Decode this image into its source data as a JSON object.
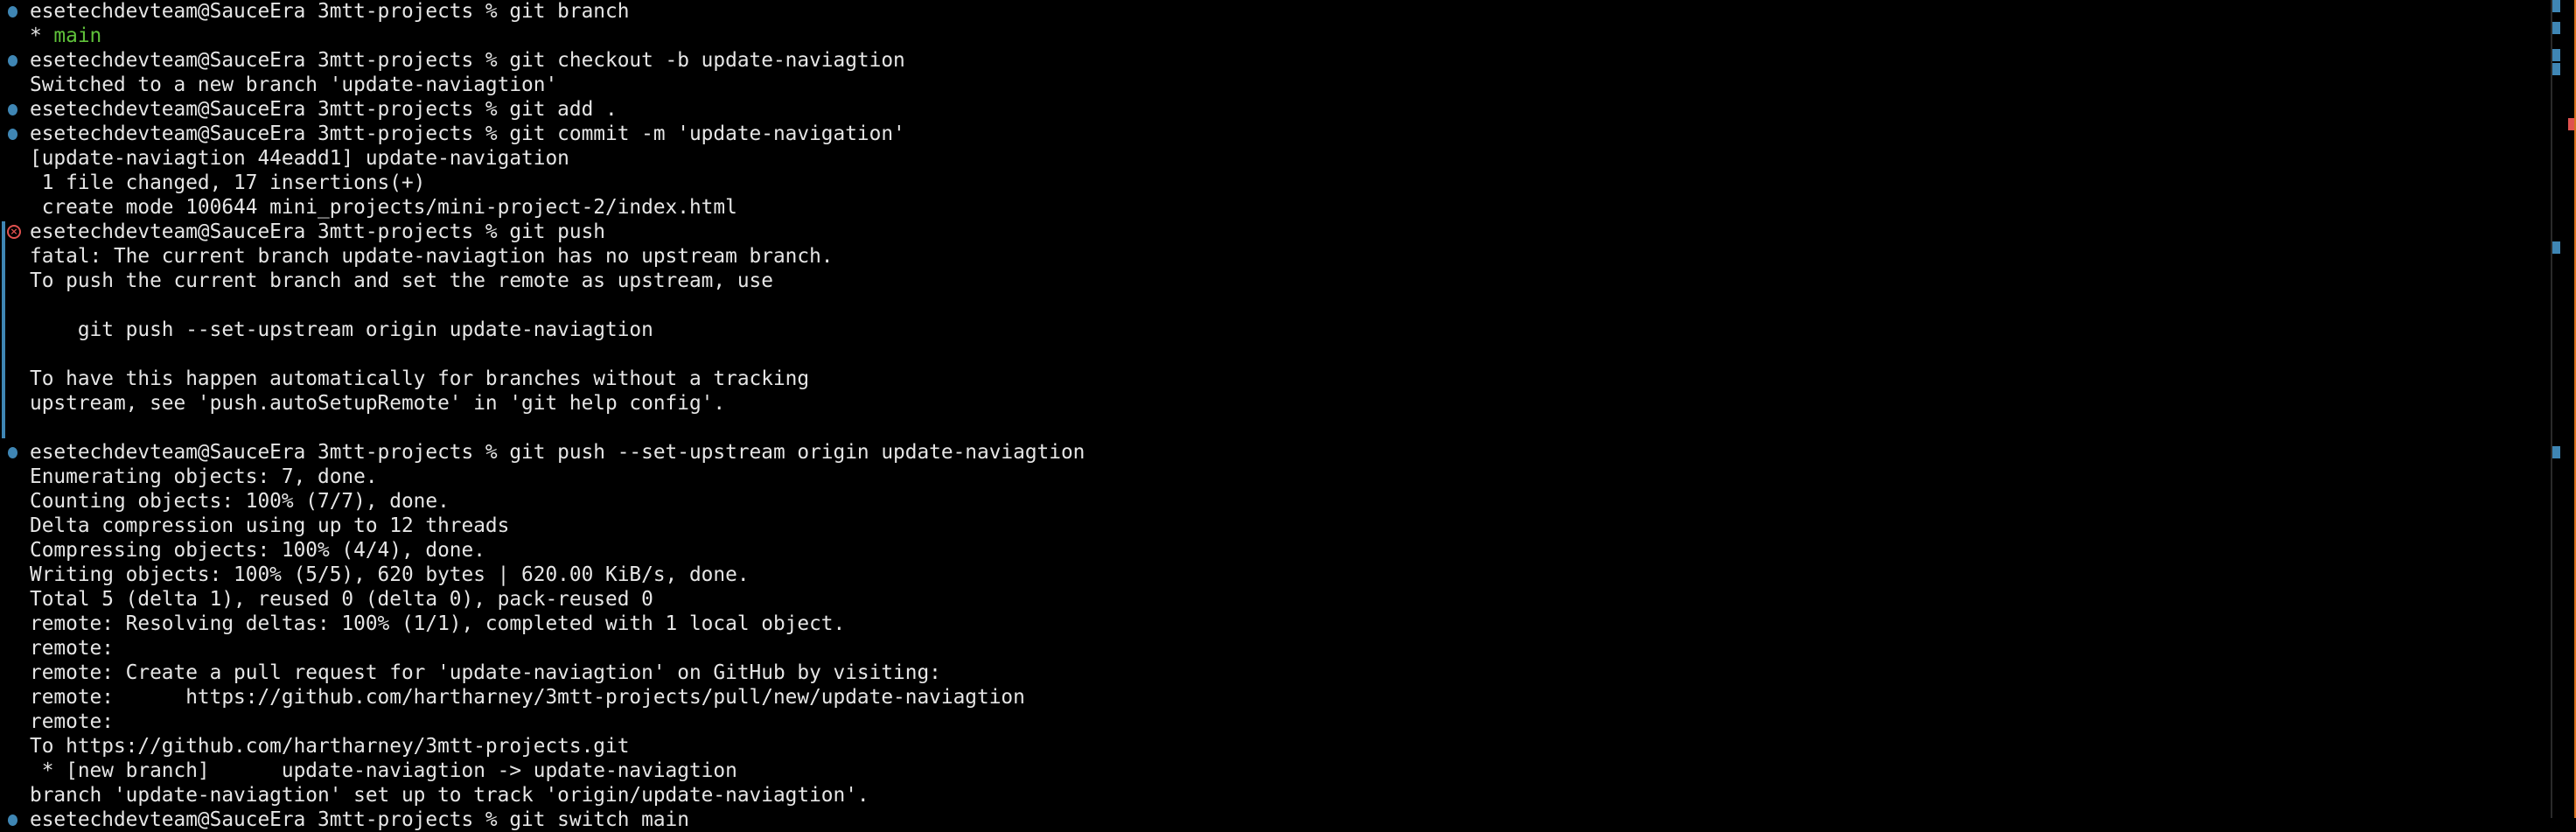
{
  "colors": {
    "background": "#000000",
    "text": "#e6e6e6",
    "success_marker": "#3f86b4",
    "error_marker": "#e0514f",
    "branch_highlight": "#5fc23a",
    "scroll_edge": "#d9731f"
  },
  "lines": [
    {
      "marker": "success",
      "segments": [
        {
          "text": "esetechdevteam@SauceEra 3mtt-projects % git branch"
        }
      ]
    },
    {
      "marker": "",
      "segments": [
        {
          "text": "* "
        },
        {
          "text": "main",
          "style": "green"
        }
      ]
    },
    {
      "marker": "success",
      "segments": [
        {
          "text": "esetechdevteam@SauceEra 3mtt-projects % git checkout -b update-naviagtion"
        }
      ]
    },
    {
      "marker": "",
      "segments": [
        {
          "text": "Switched to a new branch 'update-naviagtion'"
        }
      ]
    },
    {
      "marker": "success",
      "segments": [
        {
          "text": "esetechdevteam@SauceEra 3mtt-projects % git add ."
        }
      ]
    },
    {
      "marker": "success",
      "segments": [
        {
          "text": "esetechdevteam@SauceEra 3mtt-projects % git commit -m 'update-navigation'"
        }
      ]
    },
    {
      "marker": "",
      "segments": [
        {
          "text": "[update-naviagtion 44eadd1] update-navigation"
        }
      ]
    },
    {
      "marker": "",
      "segments": [
        {
          "text": " 1 file changed, 17 insertions(+)"
        }
      ]
    },
    {
      "marker": "",
      "segments": [
        {
          "text": " create mode 100644 mini_projects/mini-project-2/index.html"
        }
      ]
    },
    {
      "marker": "error",
      "segments": [
        {
          "text": "esetechdevteam@SauceEra 3mtt-projects % git push"
        }
      ]
    },
    {
      "marker": "",
      "segments": [
        {
          "text": "fatal: The current branch update-naviagtion has no upstream branch."
        }
      ]
    },
    {
      "marker": "",
      "segments": [
        {
          "text": "To push the current branch and set the remote as upstream, use"
        }
      ]
    },
    {
      "marker": "",
      "segments": [
        {
          "text": ""
        }
      ]
    },
    {
      "marker": "",
      "segments": [
        {
          "text": "    git push --set-upstream origin update-naviagtion"
        }
      ]
    },
    {
      "marker": "",
      "segments": [
        {
          "text": ""
        }
      ]
    },
    {
      "marker": "",
      "segments": [
        {
          "text": "To have this happen automatically for branches without a tracking"
        }
      ]
    },
    {
      "marker": "",
      "segments": [
        {
          "text": "upstream, see 'push.autoSetupRemote' in 'git help config'."
        }
      ]
    },
    {
      "marker": "",
      "segments": [
        {
          "text": ""
        }
      ]
    },
    {
      "marker": "success",
      "segments": [
        {
          "text": "esetechdevteam@SauceEra 3mtt-projects % git push --set-upstream origin update-naviagtion"
        }
      ]
    },
    {
      "marker": "",
      "segments": [
        {
          "text": "Enumerating objects: 7, done."
        }
      ]
    },
    {
      "marker": "",
      "segments": [
        {
          "text": "Counting objects: 100% (7/7), done."
        }
      ]
    },
    {
      "marker": "",
      "segments": [
        {
          "text": "Delta compression using up to 12 threads"
        }
      ]
    },
    {
      "marker": "",
      "segments": [
        {
          "text": "Compressing objects: 100% (4/4), done."
        }
      ]
    },
    {
      "marker": "",
      "segments": [
        {
          "text": "Writing objects: 100% (5/5), 620 bytes | 620.00 KiB/s, done."
        }
      ]
    },
    {
      "marker": "",
      "segments": [
        {
          "text": "Total 5 (delta 1), reused 0 (delta 0), pack-reused 0"
        }
      ]
    },
    {
      "marker": "",
      "segments": [
        {
          "text": "remote: Resolving deltas: 100% (1/1), completed with 1 local object."
        }
      ]
    },
    {
      "marker": "",
      "segments": [
        {
          "text": "remote:"
        }
      ]
    },
    {
      "marker": "",
      "segments": [
        {
          "text": "remote: Create a pull request for 'update-naviagtion' on GitHub by visiting:"
        }
      ]
    },
    {
      "marker": "",
      "segments": [
        {
          "text": "remote:      https://github.com/hartharney/3mtt-projects/pull/new/update-naviagtion"
        }
      ]
    },
    {
      "marker": "",
      "segments": [
        {
          "text": "remote:"
        }
      ]
    },
    {
      "marker": "",
      "segments": [
        {
          "text": "To https://github.com/hartharney/3mtt-projects.git"
        }
      ]
    },
    {
      "marker": "",
      "segments": [
        {
          "text": " * [new branch]      update-naviagtion -> update-naviagtion"
        }
      ]
    },
    {
      "marker": "",
      "segments": [
        {
          "text": "branch 'update-naviagtion' set up to track 'origin/update-naviagtion'."
        }
      ]
    },
    {
      "marker": "success",
      "segments": [
        {
          "text": "esetechdevteam@SauceEra 3mtt-projects % git switch main"
        }
      ]
    }
  ],
  "overview_ruler": {
    "markers": [
      "success",
      "success",
      "success",
      "success",
      "error",
      "success",
      "success"
    ]
  }
}
